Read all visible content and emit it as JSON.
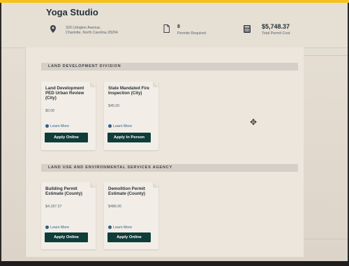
{
  "header": {
    "title": "Yoga Studio",
    "address_line1": "320 Lilington Avenue,",
    "address_line2": "Charlotte, North Carolina 28204",
    "permits_count": "8",
    "permits_label": "Permits Required",
    "total_cost": "$5,748.37",
    "total_cost_label": "Total Permit Cost"
  },
  "sections": [
    {
      "title": "LAND DEVELOPMENT DIVISION",
      "cards": [
        {
          "title": "Land Development PED Urban Review (City)",
          "price": "$0.00",
          "learn_more": "Learn More",
          "button": "Apply Online"
        },
        {
          "title": "State Mandated Fire Inspection (City)",
          "price": "$45.00",
          "learn_more": "Learn More",
          "button": "Apply In Person"
        }
      ]
    },
    {
      "title": "LAND USE AND ENVIRONMENTAL SERVICES AGENCY",
      "cards": [
        {
          "title": "Building Permit Estimate (County)",
          "price": "$4,187.37",
          "learn_more": "Learn More",
          "button": "Apply Online"
        },
        {
          "title": "Demolition Permit Estimate (County)",
          "price": "$486.00",
          "learn_more": "Learn More",
          "button": "Apply Online"
        }
      ]
    }
  ],
  "icons": {
    "location": "map-pin-icon",
    "permits": "document-icon",
    "cost": "calculator-icon",
    "info": "info-icon",
    "cursor": "move-cursor-icon"
  },
  "colors": {
    "accent_yellow": "#f6c21a",
    "button_green": "#0f3d3a",
    "link_blue": "#2d5f8a"
  }
}
